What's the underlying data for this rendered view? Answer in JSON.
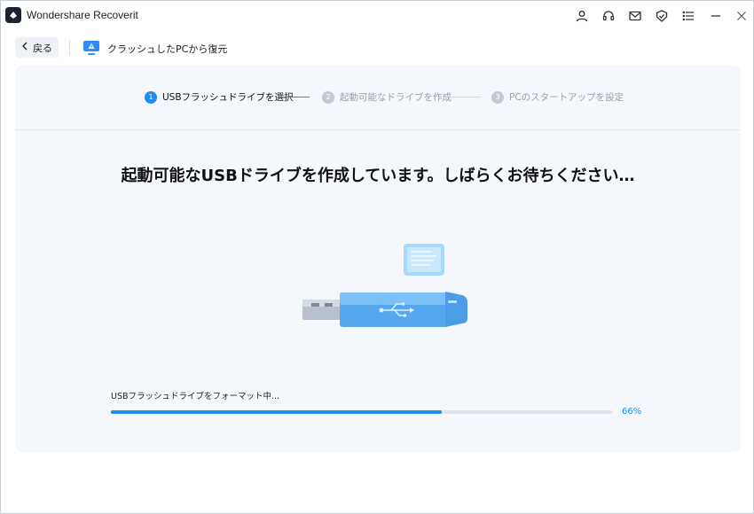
{
  "window": {
    "app_title": "Wondershare Recoverit",
    "icons": [
      "user-icon",
      "headset-icon",
      "mail-icon",
      "shield-icon",
      "menu-icon",
      "minimize-icon",
      "close-icon"
    ]
  },
  "nav": {
    "back_label": "戻る",
    "page_title": "クラッシュしたPCから復元"
  },
  "steps": [
    {
      "num": "1",
      "label": "USBフラッシュドライブを選択",
      "state": "active"
    },
    {
      "num": "2",
      "label": "起動可能なドライブを作成",
      "state": "inactive"
    },
    {
      "num": "3",
      "label": "PCのスタートアップを設定",
      "state": "inactive"
    }
  ],
  "main": {
    "heading": "起動可能なUSBドライブを作成しています。しばらくお待ちください…"
  },
  "progress": {
    "label": "USBフラッシュドライブをフォーマット中...",
    "percent_text": "66%",
    "value": 0.66
  },
  "colors": {
    "accent": "#1e8cf0",
    "inactive_step": "#c4c9d1",
    "inactive_text": "#9aa0a8",
    "panel_bg": "#f4f7fb"
  }
}
